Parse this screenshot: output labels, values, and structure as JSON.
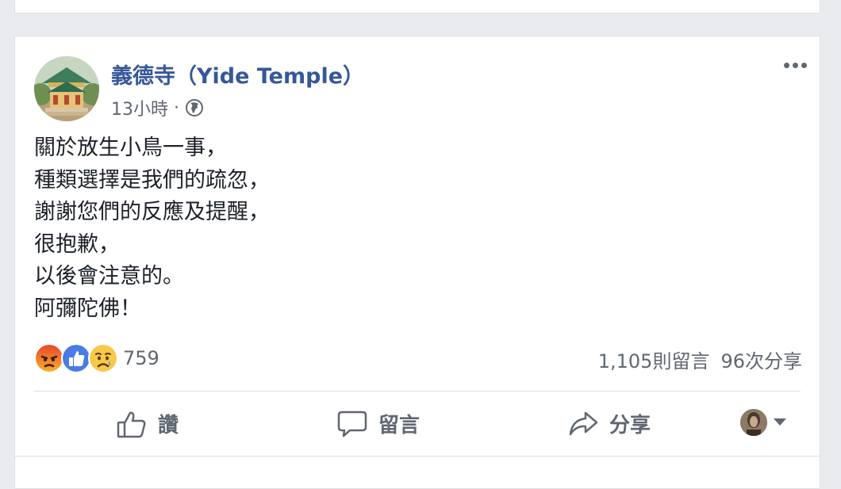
{
  "post": {
    "author": "義德寺（Yide Temple）",
    "time": "13小時",
    "separator": "·",
    "privacy_icon": "globe-icon",
    "menu_icon": "more-options-icon",
    "lines": [
      "關於放生小鳥一事，",
      "種類選擇是我們的疏忽，",
      "謝謝您們的反應及提醒，",
      "很抱歉，",
      "以後會注意的。",
      "阿彌陀佛！"
    ],
    "reactions": {
      "icons": [
        "angry-reaction-icon",
        "like-reaction-icon",
        "sad-reaction-icon"
      ],
      "count": "759"
    },
    "comments": "1,105則留言",
    "shares": "96次分享",
    "actions": {
      "like": "讚",
      "comment": "留言",
      "share": "分享"
    }
  },
  "colors": {
    "author_link": "#365899",
    "meta_gray": "#616770",
    "page_bg": "#e9ebee",
    "like_blue": "#4a7be6",
    "angry_orange": "#f06025"
  }
}
